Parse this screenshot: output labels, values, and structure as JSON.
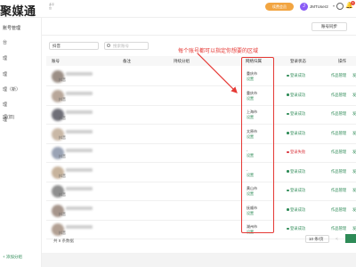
{
  "header": {
    "logo": "聚媒通",
    "logo_sub": "多平台",
    "vip_label": "续费会员",
    "avatar_letter": "J",
    "username": "JMTUser2",
    "notification_count": "1"
  },
  "sidebar": {
    "title": "账号管理",
    "items": [
      "台",
      "理",
      "理",
      "理（新）",
      "理",
      "理",
      "理(旧)"
    ],
    "add_label": "+ 添加分组"
  },
  "toolbar": {
    "sync_label": "账号同步",
    "platform_value": "抖音",
    "search_placeholder": "搜索账号"
  },
  "table": {
    "headers": [
      "账号",
      "备注",
      "持续分组",
      "网络归属",
      "登录状态",
      "操作"
    ],
    "rows": [
      {
        "platform": "抖音",
        "region": "重庆市",
        "set": "设置",
        "status": "登录成功",
        "status_type": "ok",
        "op": "作品管理",
        "op2": "发"
      },
      {
        "platform": "抖音",
        "region": "重庆市",
        "set": "设置",
        "status": "登录成功",
        "status_type": "ok",
        "op": "作品管理",
        "op2": "发"
      },
      {
        "platform": "抖音",
        "region": "上海市",
        "set": "设置",
        "status": "登录成功",
        "status_type": "ok",
        "op": "作品管理",
        "op2": "发"
      },
      {
        "platform": "抖音",
        "region": "太原市",
        "set": "设置",
        "status": "登录成功",
        "status_type": "ok",
        "op": "作品管理",
        "op2": "发"
      },
      {
        "platform": "抖音",
        "region": "-",
        "set": "设置",
        "status": "登录失败",
        "status_type": "fail",
        "op": "作品管理",
        "op2": "发"
      },
      {
        "platform": "抖音",
        "region": "-",
        "set": "设置",
        "status": "登录成功",
        "status_type": "ok",
        "op": "作品管理",
        "op2": "发"
      },
      {
        "platform": "抖音",
        "region": "黄山市",
        "set": "设置",
        "status": "登录成功",
        "status_type": "ok",
        "op": "作品管理",
        "op2": "发"
      },
      {
        "platform": "抖音",
        "region": "抚顺市",
        "set": "设置",
        "status": "登录成功",
        "status_type": "ok",
        "op": "作品管理",
        "op2": "发"
      },
      {
        "platform": "抖音",
        "region": "湖州市",
        "set": "设置",
        "status": "登录成功",
        "status_type": "ok",
        "op": "作品管理",
        "op2": "发"
      }
    ]
  },
  "annotation": "每个账号都可以指定你想要的区域",
  "footer": {
    "total": "共 9 条数据",
    "page_size": "10 条/页",
    "prev": "<"
  },
  "colors": {
    "accent": "#2e8b57",
    "annotation": "#e53935",
    "vip": "#f2a541",
    "error": "#d9363e"
  }
}
